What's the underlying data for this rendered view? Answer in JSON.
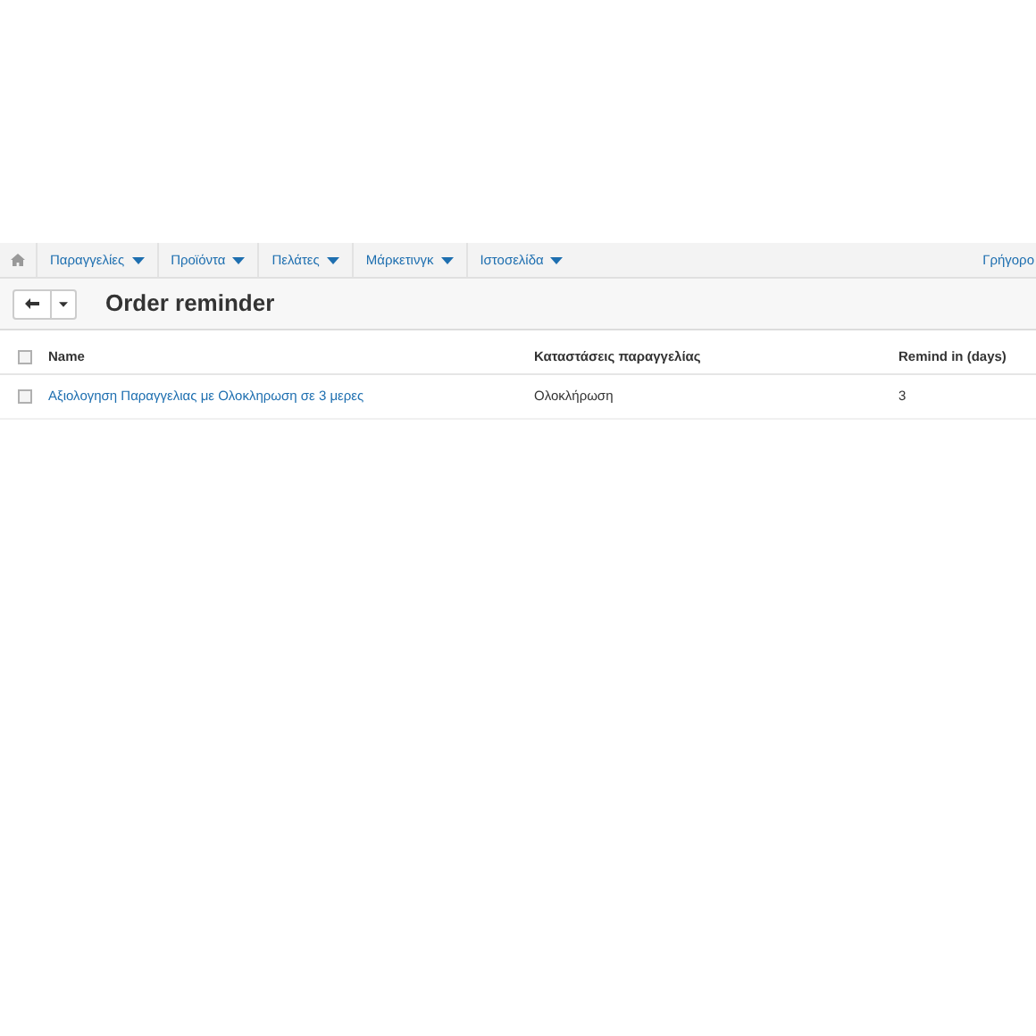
{
  "nav": {
    "items": [
      {
        "label": "Παραγγελίες"
      },
      {
        "label": "Προϊόντα"
      },
      {
        "label": "Πελάτες"
      },
      {
        "label": "Μάρκετινγκ"
      },
      {
        "label": "Ιστοσελίδα"
      }
    ],
    "right_link": "Γρήγορο"
  },
  "header": {
    "title": "Order reminder"
  },
  "table": {
    "select_all_checked": false,
    "columns": [
      "Name",
      "Καταστάσεις παραγγελίας",
      "Remind in (days)"
    ],
    "rows": [
      {
        "checked": false,
        "name": "Αξιολογηση Παραγγελιας με Ολοκληρωση σε 3 μερες",
        "status": "Ολοκλήρωση",
        "days": "3"
      }
    ]
  }
}
